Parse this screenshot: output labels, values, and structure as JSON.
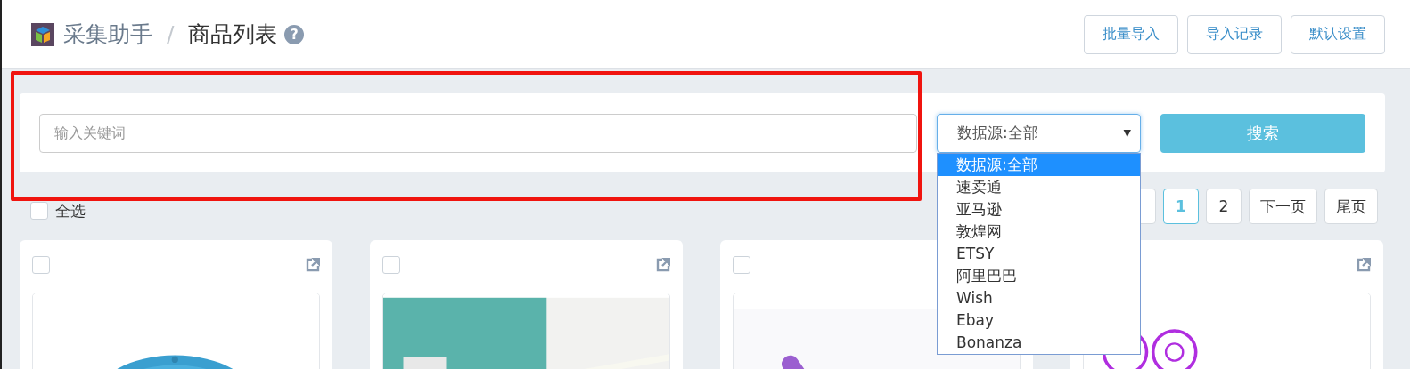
{
  "header": {
    "app_name": "采集助手",
    "separator": "/",
    "page_title": "商品列表",
    "help": "?",
    "buttons": [
      "批量导入",
      "导入记录",
      "默认设置"
    ]
  },
  "search": {
    "placeholder": "输入关键词",
    "source_select": {
      "value": "数据源:全部",
      "arrow": "▼",
      "expanded": true,
      "options": [
        {
          "label": "数据源:全部",
          "selected": true
        },
        {
          "label": "速卖通",
          "selected": false
        },
        {
          "label": "亚马逊",
          "selected": false
        },
        {
          "label": "敦煌网",
          "selected": false
        },
        {
          "label": "ETSY",
          "selected": false
        },
        {
          "label": "阿里巴巴",
          "selected": false
        },
        {
          "label": "Wish",
          "selected": false
        },
        {
          "label": "Ebay",
          "selected": false
        },
        {
          "label": "Bonanza",
          "selected": false
        }
      ]
    },
    "button": "搜索"
  },
  "select_all": {
    "label": "全选",
    "checked": false
  },
  "pagination": [
    {
      "label": "1",
      "selected": true
    },
    {
      "label": "2",
      "selected": false
    },
    {
      "label": "下一页",
      "selected": false
    },
    {
      "label": "尾页",
      "selected": false
    }
  ],
  "products": [
    {
      "checked": false,
      "link_icon": true,
      "kind": "picture"
    },
    {
      "checked": false,
      "link_icon": true,
      "kind": "picture"
    },
    {
      "checked": false,
      "link_icon": false,
      "kind": "picture"
    },
    {
      "link_icon": true,
      "kind": "picture"
    }
  ],
  "annotation": {
    "highlight": true
  }
}
